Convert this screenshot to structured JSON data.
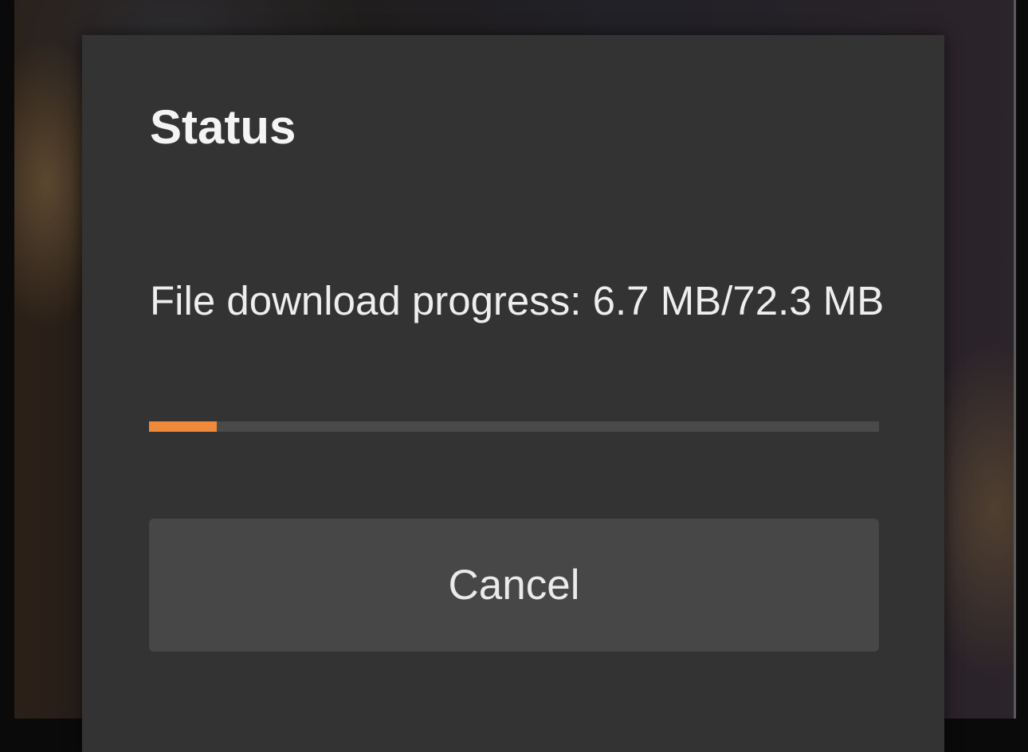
{
  "dialog": {
    "title": "Status",
    "progress_text": "File download progress: 6.7 MB/72.3 MB",
    "progress_fraction": 0.0927,
    "cancel_label": "Cancel"
  },
  "colors": {
    "dialog_background": "#333333",
    "progress_fill": "#f08a3a",
    "progress_track": "#4a4a4a",
    "button_background": "#474747"
  }
}
